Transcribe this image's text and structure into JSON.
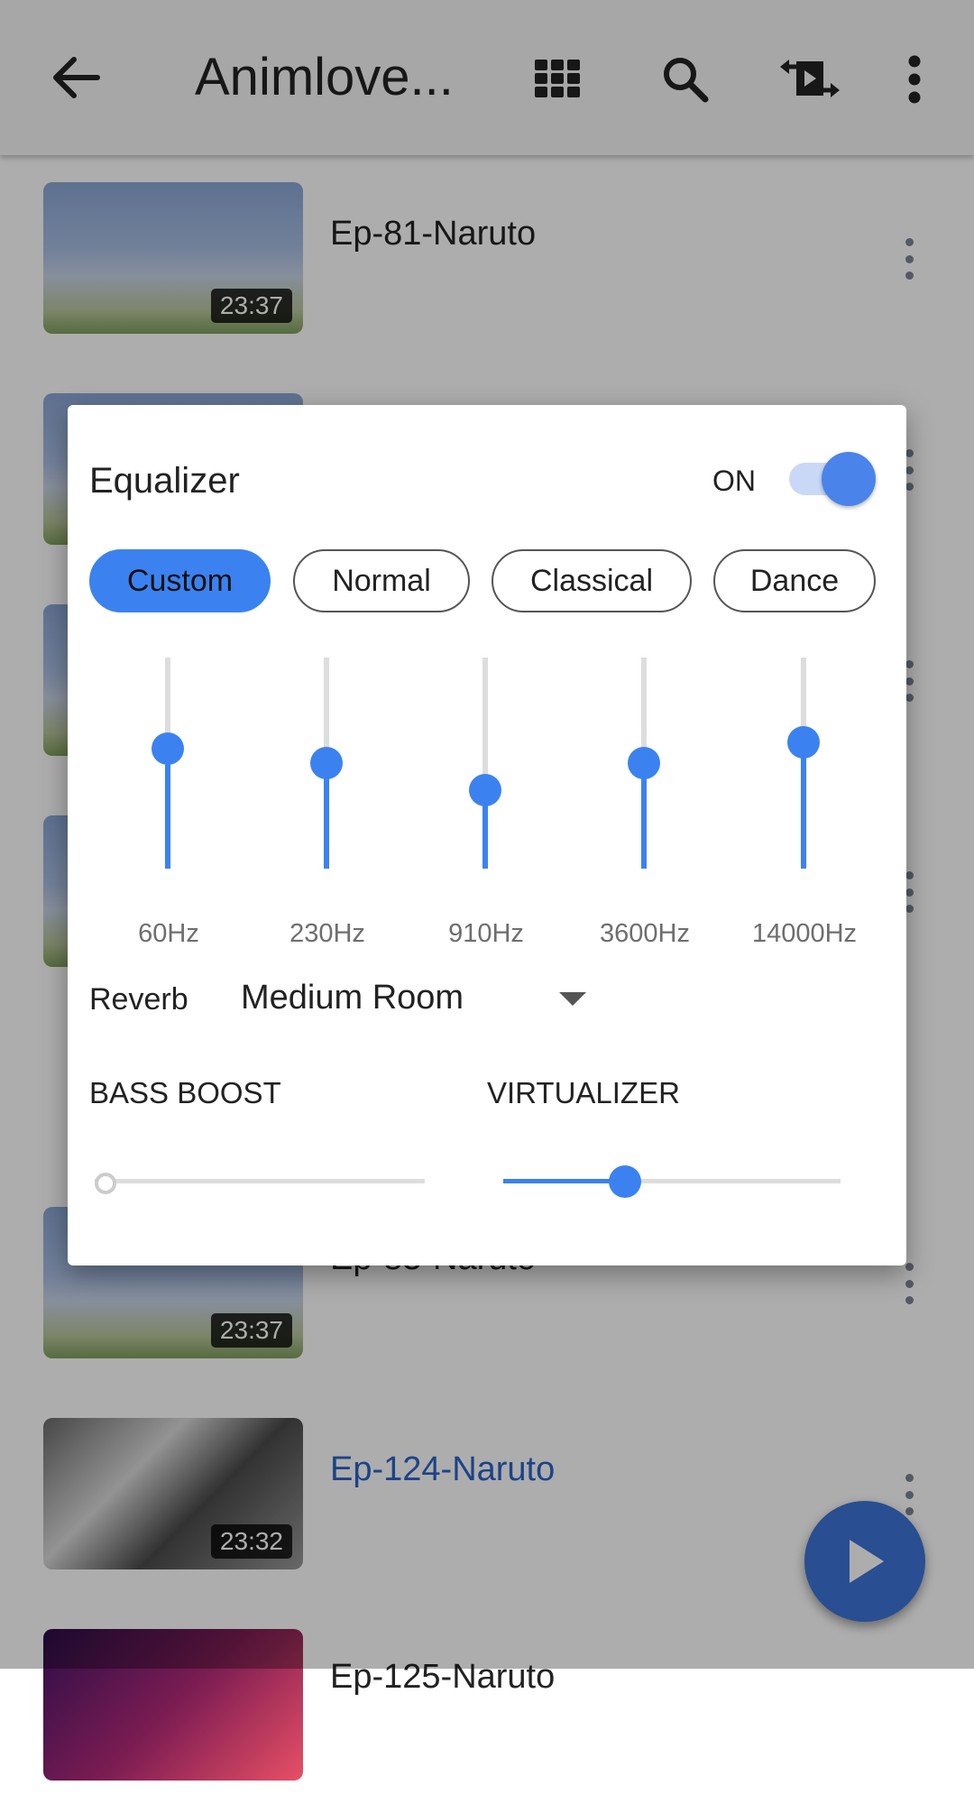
{
  "app": {
    "title": "Animlove..."
  },
  "toolbar": {
    "icons": [
      "back-arrow-icon",
      "grid-icon",
      "search-icon",
      "media-cast-icon",
      "more-vert-icon"
    ]
  },
  "episodes": [
    {
      "title": "Ep-81-Naruto",
      "duration": "23:37",
      "active": false
    },
    {
      "title": "Ep-83-Naruto",
      "duration": "23:37",
      "active": false
    },
    {
      "title": "Ep-124-Naruto",
      "duration": "23:32",
      "active": true
    },
    {
      "title": "Ep-125-Naruto",
      "duration": "",
      "active": false
    }
  ],
  "equalizer": {
    "title": "Equalizer",
    "toggle_label": "ON",
    "enabled": true,
    "presets": [
      "Custom",
      "Normal",
      "Classical",
      "Dance"
    ],
    "selected_preset": "Custom",
    "bands": [
      {
        "freq": "60Hz",
        "level": 0.57
      },
      {
        "freq": "230Hz",
        "level": 0.5
      },
      {
        "freq": "910Hz",
        "level": 0.37
      },
      {
        "freq": "3600Hz",
        "level": 0.5
      },
      {
        "freq": "14000Hz",
        "level": 0.6
      }
    ],
    "reverb_label": "Reverb",
    "reverb_value": "Medium Room",
    "bass_boost_label": "BASS BOOST",
    "bass_boost_level": 0.0,
    "virtualizer_label": "VIRTUALIZER",
    "virtualizer_level": 0.36
  },
  "colors": {
    "accent": "#3b82f0",
    "fab": "#3d73d6",
    "active_title": "#2b63c9"
  },
  "fab": {
    "icon": "play-icon"
  }
}
